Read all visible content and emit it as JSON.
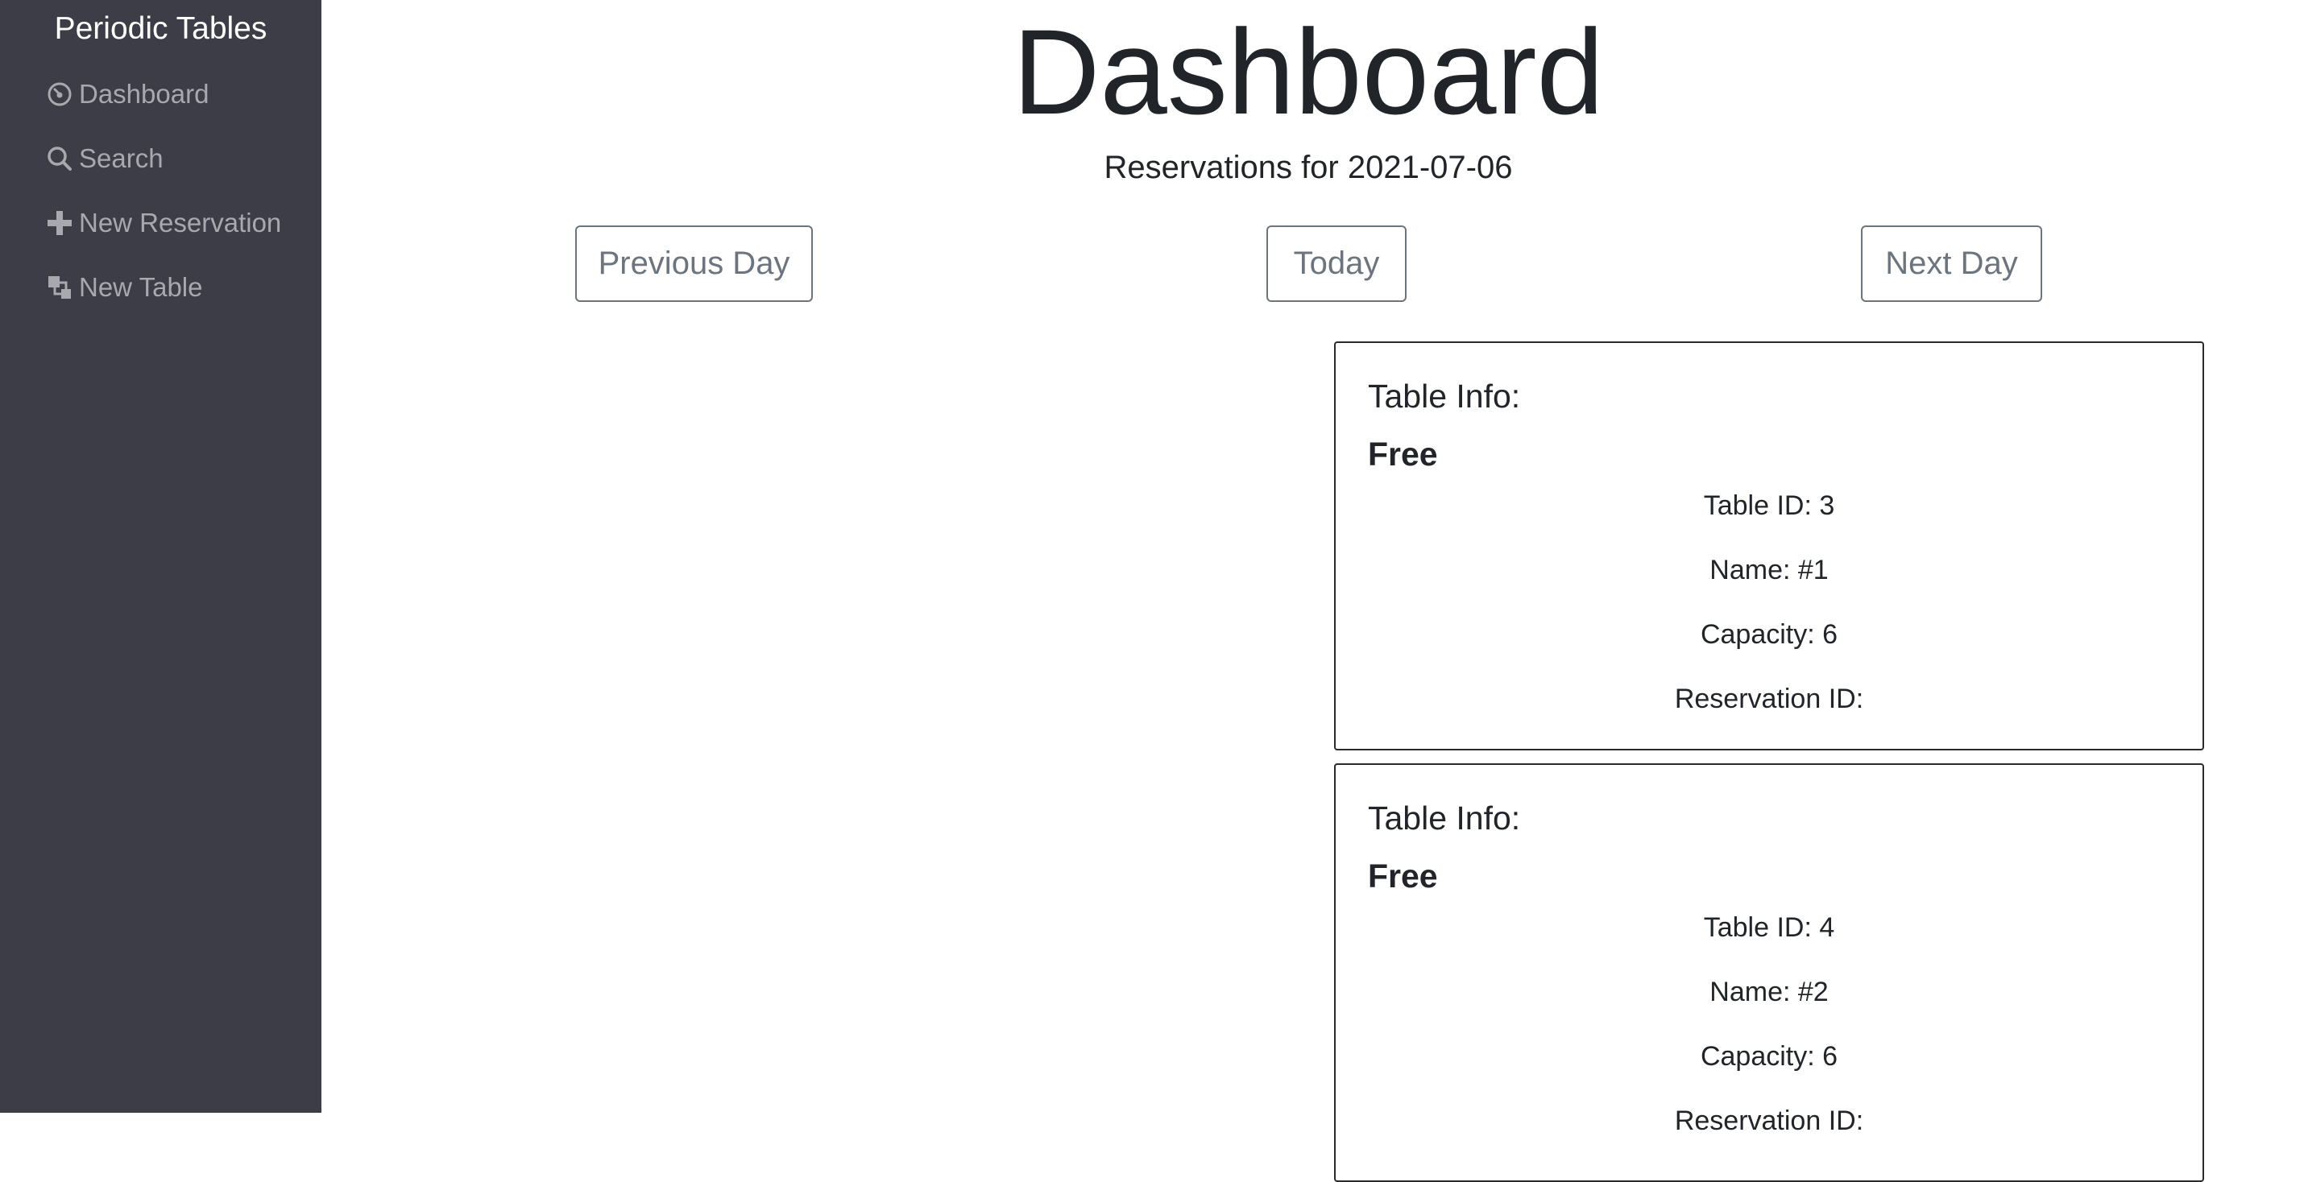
{
  "sidebar": {
    "brand": "Periodic Tables",
    "items": [
      {
        "label": "Dashboard",
        "icon": "dashboard-gauge-icon"
      },
      {
        "label": "Search",
        "icon": "search-icon"
      },
      {
        "label": "New Reservation",
        "icon": "plus-icon"
      },
      {
        "label": "New Table",
        "icon": "layers-icon"
      }
    ]
  },
  "main": {
    "title": "Dashboard",
    "subtitle": "Reservations for 2021-07-06",
    "buttons": {
      "previous": "Previous Day",
      "today": "Today",
      "next": "Next Day"
    },
    "tables": [
      {
        "header": "Table Info:",
        "status": "Free",
        "table_id": "Table ID: 3",
        "name": "Name: #1",
        "capacity": "Capacity: 6",
        "reservation_id": "Reservation ID:"
      },
      {
        "header": "Table Info:",
        "status": "Free",
        "table_id": "Table ID: 4",
        "name": "Name: #2",
        "capacity": "Capacity: 6",
        "reservation_id": "Reservation ID:"
      }
    ]
  },
  "colors": {
    "sidebar_bg": "#3c3d46",
    "sidebar_text": "#a8a9ae",
    "button_border": "#6c757d"
  }
}
